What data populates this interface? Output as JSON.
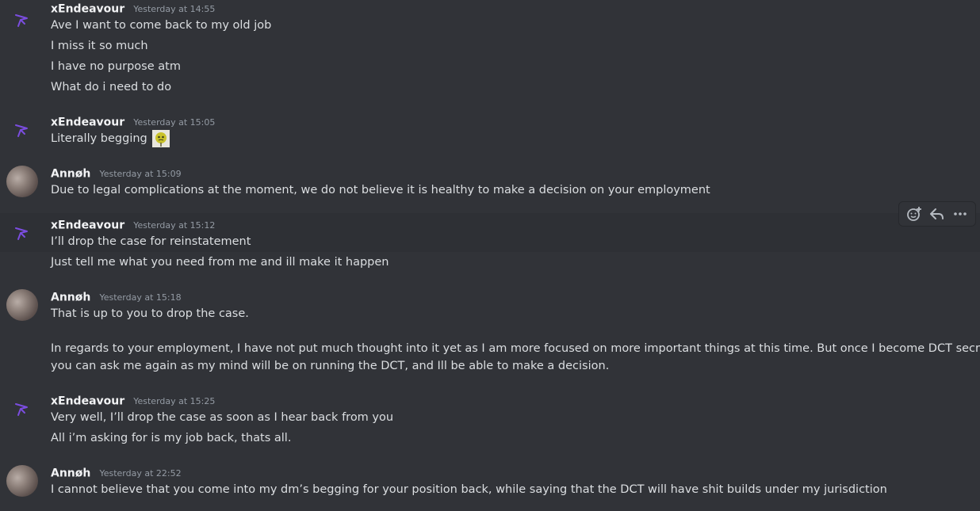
{
  "colors": {
    "background": "#313338",
    "hover_row": "#2e3035",
    "username": "#f2f3f5",
    "timestamp": "#949ba4",
    "text": "#dbdee1",
    "accent_purple": "#7b4de0"
  },
  "hover_toolbar": {
    "add_reaction_icon": "add-reaction-icon",
    "reply_icon": "reply-icon",
    "more_icon": "more-icon"
  },
  "messages": [
    {
      "author": "xEndeavour",
      "time": "Yesterday at 14:55",
      "lines": [
        "Ave I want to come back to my old job",
        "I miss it so much",
        "I have no purpose atm",
        "What do i need to do"
      ]
    },
    {
      "author": "xEndeavour",
      "time": "Yesterday at 15:05",
      "lines": [
        "Literally begging"
      ],
      "emoji": "pleading-emoji"
    },
    {
      "author": "Annøh",
      "time": "Yesterday at 15:09",
      "lines": [
        "Due to legal complications at the moment, we do not believe it is healthy to make a decision on your employment"
      ]
    },
    {
      "author": "xEndeavour",
      "time": "Yesterday at 15:12",
      "lines": [
        "I’ll drop the case for reinstatement",
        "Just tell me what you need from me and ill make it happen"
      ]
    },
    {
      "author": "Annøh",
      "time": "Yesterday at 15:18",
      "lines": [
        "That is up to you to drop the case.",
        "In regards to your employment, I have not put much thought into it yet as I am more focused on more important things at this time. But once I become DCT secretary,",
        "you can ask me again as my mind will be on running the DCT, and Ill be able to make a decision."
      ]
    },
    {
      "author": "xEndeavour",
      "time": "Yesterday at 15:25",
      "lines": [
        "Very well, I’ll drop the case as soon as I hear back from you",
        "All i’m asking for is my job back, thats all."
      ]
    },
    {
      "author": "Annøh",
      "time": "Yesterday at 22:52",
      "lines": [
        "I cannot believe that you come into my dm’s begging for your position back, while saying that the DCT will have shit builds under my jurisdiction"
      ]
    }
  ]
}
